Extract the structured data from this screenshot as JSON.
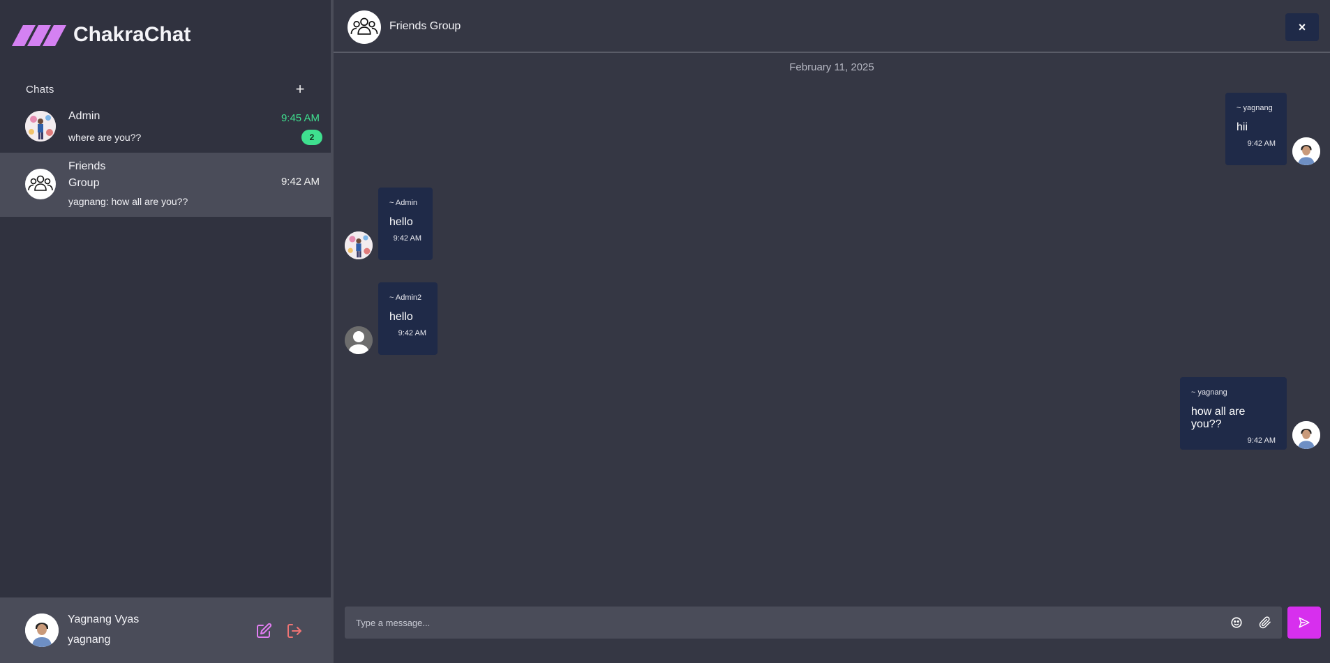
{
  "app": {
    "name": "ChakraChat"
  },
  "sidebar": {
    "chats_title": "Chats",
    "add_label": "+",
    "items": [
      {
        "name": "Admin",
        "preview": "where are you??",
        "time": "9:45 AM",
        "unread": "2"
      },
      {
        "name_line1": "Friends",
        "name_line2": "Group",
        "preview": "yagnang: how all are you??",
        "time": "9:42 AM"
      }
    ]
  },
  "profile": {
    "name": "Yagnang Vyas",
    "username": "yagnang"
  },
  "conversation": {
    "title": "Friends Group",
    "close_label": "×",
    "date": "February 11, 2025",
    "messages": [
      {
        "sender": "~ yagnang",
        "text": "hii",
        "time": "9:42 AM"
      },
      {
        "sender": "~ Admin",
        "text": "hello",
        "time": "9:42 AM"
      },
      {
        "sender": "~ Admin2",
        "text": "hello",
        "time": "9:42 AM"
      },
      {
        "sender": "~ yagnang",
        "text": "how all are you??",
        "time": "9:42 AM"
      }
    ]
  },
  "composer": {
    "placeholder": "Type a message..."
  },
  "colors": {
    "accent": "#d72fee",
    "unread": "#3fe08f",
    "bubble": "#1f2a48",
    "brand": "#d481f2"
  }
}
